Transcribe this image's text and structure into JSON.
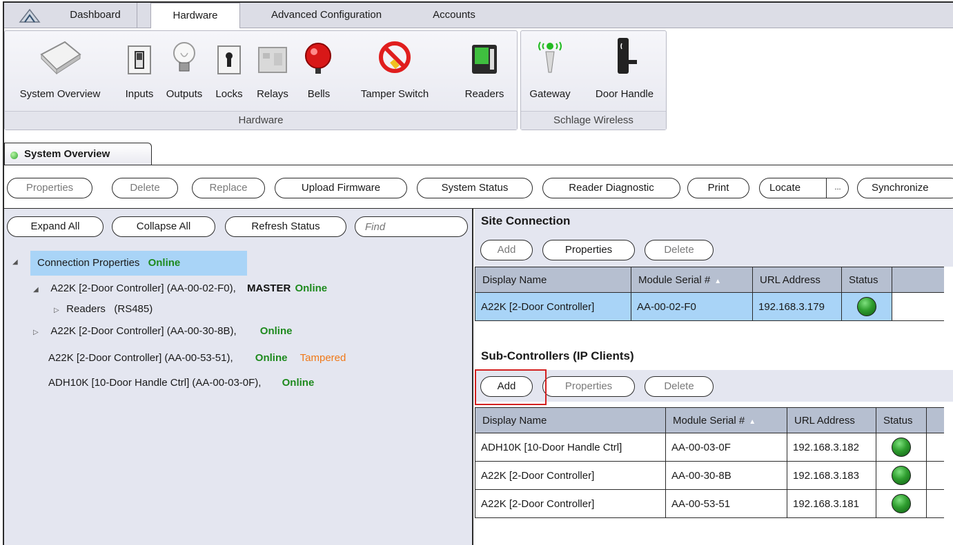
{
  "ribbon_tabs": [
    {
      "label": "Dashboard"
    },
    {
      "label": "Hardware"
    },
    {
      "label": "Advanced Configuration"
    },
    {
      "label": "Accounts"
    }
  ],
  "hardware_group": {
    "label": "Hardware",
    "buttons": [
      {
        "label": "System Overview",
        "icon": "system-overview-icon"
      },
      {
        "label": "Inputs",
        "icon": "switch-icon"
      },
      {
        "label": "Outputs",
        "icon": "bulb-icon"
      },
      {
        "label": "Locks",
        "icon": "lock-icon"
      },
      {
        "label": "Relays",
        "icon": "relay-icon"
      },
      {
        "label": "Bells",
        "icon": "bell-icon"
      },
      {
        "label": "Tamper Switch",
        "icon": "tamper-icon"
      },
      {
        "label": "Readers",
        "icon": "reader-icon"
      }
    ]
  },
  "schlage_group": {
    "label": "Schlage Wireless",
    "buttons": [
      {
        "label": "Gateway",
        "icon": "gateway-icon"
      },
      {
        "label": "Door Handle",
        "icon": "door-handle-icon"
      }
    ]
  },
  "document_tab": {
    "label": "System Overview"
  },
  "toolbar": {
    "properties": "Properties",
    "delete": "Delete",
    "replace": "Replace",
    "upload_firmware": "Upload Firmware",
    "system_status": "System Status",
    "reader_diagnostic": "Reader Diagnostic",
    "print": "Print",
    "locate": "Locate",
    "locate_more": "...",
    "synchronize": "Synchronize"
  },
  "left_pane": {
    "expand_all": "Expand All",
    "collapse_all": "Collapse All",
    "refresh_status": "Refresh Status",
    "find_placeholder": "Find",
    "tree": {
      "root_label": "Connection Properties",
      "root_status": "Online",
      "nodes": [
        {
          "label": "A22K [2-Door Controller] (AA-00-02-F0),",
          "role": "MASTER",
          "status": "Online"
        },
        {
          "label": "Readers   (RS485)"
        },
        {
          "label": "A22K [2-Door Controller] (AA-00-30-8B),",
          "status": "Online"
        },
        {
          "label": "A22K [2-Door Controller] (AA-00-53-51),",
          "status": "Online",
          "alert": "Tampered"
        },
        {
          "label": "ADH10K [10-Door Handle Ctrl] (AA-00-03-0F),",
          "status": "Online"
        }
      ]
    }
  },
  "site_connection": {
    "title": "Site Connection",
    "add": "Add",
    "properties": "Properties",
    "delete": "Delete",
    "columns": [
      "Display Name",
      "Module Serial #",
      "URL Address",
      "Status"
    ],
    "rows": [
      {
        "name": "A22K [2-Door Controller]",
        "serial": "AA-00-02-F0",
        "url": "192.168.3.179"
      }
    ]
  },
  "sub_controllers": {
    "title": "Sub-Controllers (IP Clients)",
    "add": "Add",
    "properties": "Properties",
    "delete": "Delete",
    "columns": [
      "Display Name",
      "Module Serial #",
      "URL Address",
      "Status"
    ],
    "rows": [
      {
        "name": "ADH10K [10-Door Handle Ctrl]",
        "serial": "AA-00-03-0F",
        "url": "192.168.3.182"
      },
      {
        "name": "A22K [2-Door Controller]",
        "serial": "AA-00-30-8B",
        "url": "192.168.3.183"
      },
      {
        "name": "A22K [2-Door Controller]",
        "serial": "AA-00-53-51",
        "url": "192.168.3.181"
      }
    ]
  },
  "colors": {
    "online": "#1e8a1e",
    "tampered": "#f07818",
    "selection": "#a9d4f7",
    "highlight_box": "#d32020"
  }
}
